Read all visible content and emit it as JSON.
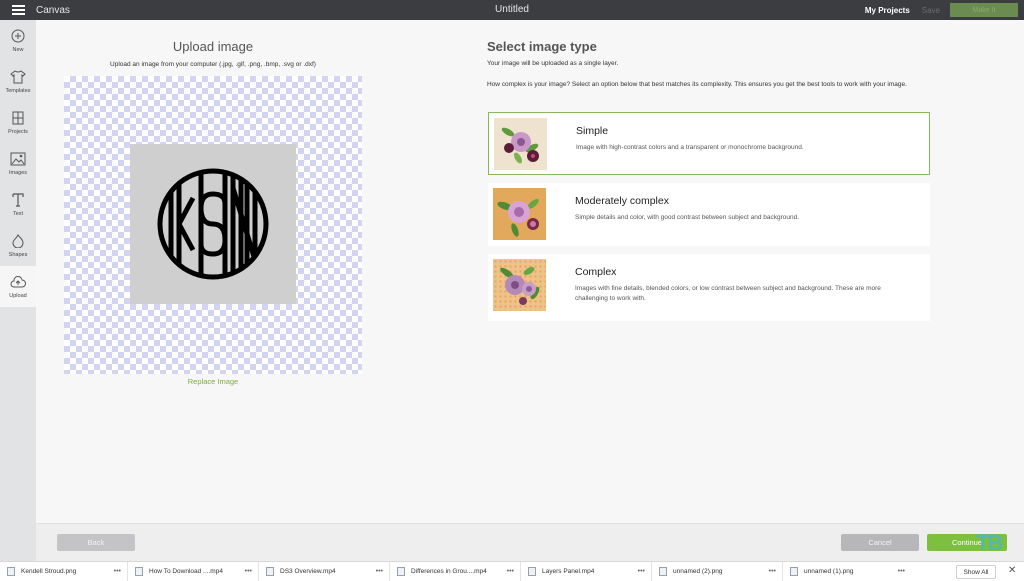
{
  "topbar": {
    "app_name": "Canvas",
    "doc_title": "Untitled",
    "my_projects": "My Projects",
    "save": "Save",
    "make": "Make It"
  },
  "sidebar": {
    "items": [
      {
        "label": "New",
        "icon": "plus-circle-icon"
      },
      {
        "label": "Templates",
        "icon": "shirt-icon"
      },
      {
        "label": "Projects",
        "icon": "projects-icon"
      },
      {
        "label": "Images",
        "icon": "image-icon"
      },
      {
        "label": "Text",
        "icon": "text-icon"
      },
      {
        "label": "Shapes",
        "icon": "shapes-icon"
      },
      {
        "label": "Upload",
        "icon": "cloud-upload-icon"
      }
    ]
  },
  "upload": {
    "title": "Upload image",
    "subtitle": "Upload an image from your computer (.jpg, .gif, .png, .bmp, .svg or .dxf)",
    "monogram": "KSN",
    "replace_link": "Replace Image"
  },
  "image_type": {
    "title": "Select image type",
    "note": "Your image will be uploaded as a single layer.",
    "help": "How complex is your image? Select an option below that best matches its complexity. This ensures you get the best tools to work with your image.",
    "options": [
      {
        "title": "Simple",
        "description": "Image with high-contrast colors and a transparent or monochrome background.",
        "selected": true
      },
      {
        "title": "Moderately complex",
        "description": "Simple details and color, with good contrast between subject and background.",
        "selected": false
      },
      {
        "title": "Complex",
        "description": "Images with fine details, blended colors, or low contrast between subject and background. These are more challenging to work with.",
        "selected": false
      }
    ]
  },
  "buttons": {
    "back": "Back",
    "cancel": "Cancel",
    "continue": "Continue"
  },
  "watermark": "TB",
  "downloads": {
    "items": [
      "Kendell Stroud.png",
      "How To Download ....mp4",
      "DS3 Overview.mp4",
      "Differences in Grou....mp4",
      "Layers Panel.mp4",
      "unnamed (2).png",
      "unnamed (1).png"
    ],
    "show_all": "Show All"
  },
  "colors": {
    "accent_green": "#7dbf3f",
    "topbar": "#3b3d40",
    "selected_border": "#86b85c"
  }
}
